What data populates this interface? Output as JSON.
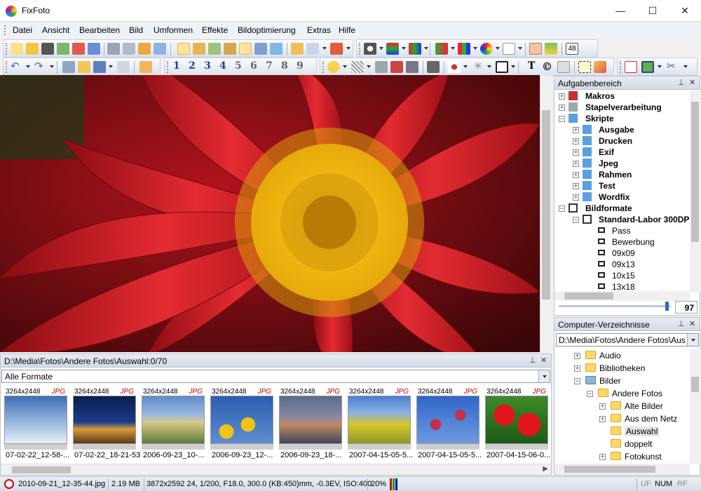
{
  "window": {
    "title": "FixFoto"
  },
  "menu": {
    "items": [
      "Datei",
      "Ansicht",
      "Bearbeiten",
      "Bild",
      "Umformen",
      "Effekte",
      "Bildoptimierung",
      "Extras",
      "Hilfe"
    ]
  },
  "toolbar": {
    "numbers": [
      "1",
      "2",
      "3",
      "4",
      "5",
      "6",
      "7",
      "8",
      "9"
    ],
    "badge": "48",
    "text_tool": "T",
    "copyright_tool": "©"
  },
  "task_panel": {
    "title": "Aufgabenbereich",
    "items": [
      "Makros",
      "Stapelverarbeitung",
      "Skripte",
      "Ausgabe",
      "Drucken",
      "Exif",
      "Jpeg",
      "Rahmen",
      "Test",
      "Wordfix",
      "Bildformate",
      "Standard-Labor 300DPI",
      "Pass",
      "Bewerbung",
      "09x09",
      "09x13",
      "10x15",
      "13x18"
    ],
    "zoom_value": "97"
  },
  "dir_panel": {
    "title": "Computer-Verzeichnisse",
    "path": "D:\\Media\\Fotos\\Andere Fotos\\Aus",
    "items": [
      "Audio",
      "Bibliotheken",
      "Bilder",
      "Andere Fotos",
      "Alte Bilder",
      "Aus dem Netz",
      "Auswahl",
      "doppelt",
      "Fotokunst"
    ]
  },
  "thumb_panel": {
    "title": "D:\\Media\\Fotos\\Andere Fotos\\Auswahl:0/70",
    "filter": "Alle Formate",
    "thumbs": [
      {
        "res": "3264x2448",
        "fmt": "JPG",
        "name": "07-02-22_12-58-..."
      },
      {
        "res": "3264x2448",
        "fmt": "JPG",
        "name": "07-02-22_18-21-53"
      },
      {
        "res": "3264x2448",
        "fmt": "JPG",
        "name": "2006-09-23_10-..."
      },
      {
        "res": "3264x2448",
        "fmt": "JPG",
        "name": "2006-09-23_12-..."
      },
      {
        "res": "3264x2448",
        "fmt": "JPG",
        "name": "2006-09-23_18-..."
      },
      {
        "res": "3264x2448",
        "fmt": "JPG",
        "name": "2007-04-15-05-5..."
      },
      {
        "res": "3264x2448",
        "fmt": "JPG",
        "name": "2007-04-15-05-5..."
      },
      {
        "res": "3264x2448",
        "fmt": "JPG",
        "name": "2007-04-15-06-0..."
      }
    ]
  },
  "status": {
    "file": "2010-09-21_12-35-44.jpg",
    "size": "2.19 MB",
    "info": "3872x2592 24, 1/200, F18.0, 300.0 (KB:450)mm, -0.3EV, ISO:400",
    "zoom": "20%",
    "uf": "UF",
    "num": "NUM",
    "rf": "RF"
  },
  "colors": {
    "accent": "#ffe49b",
    "panel_header": "#d3dbe6"
  }
}
